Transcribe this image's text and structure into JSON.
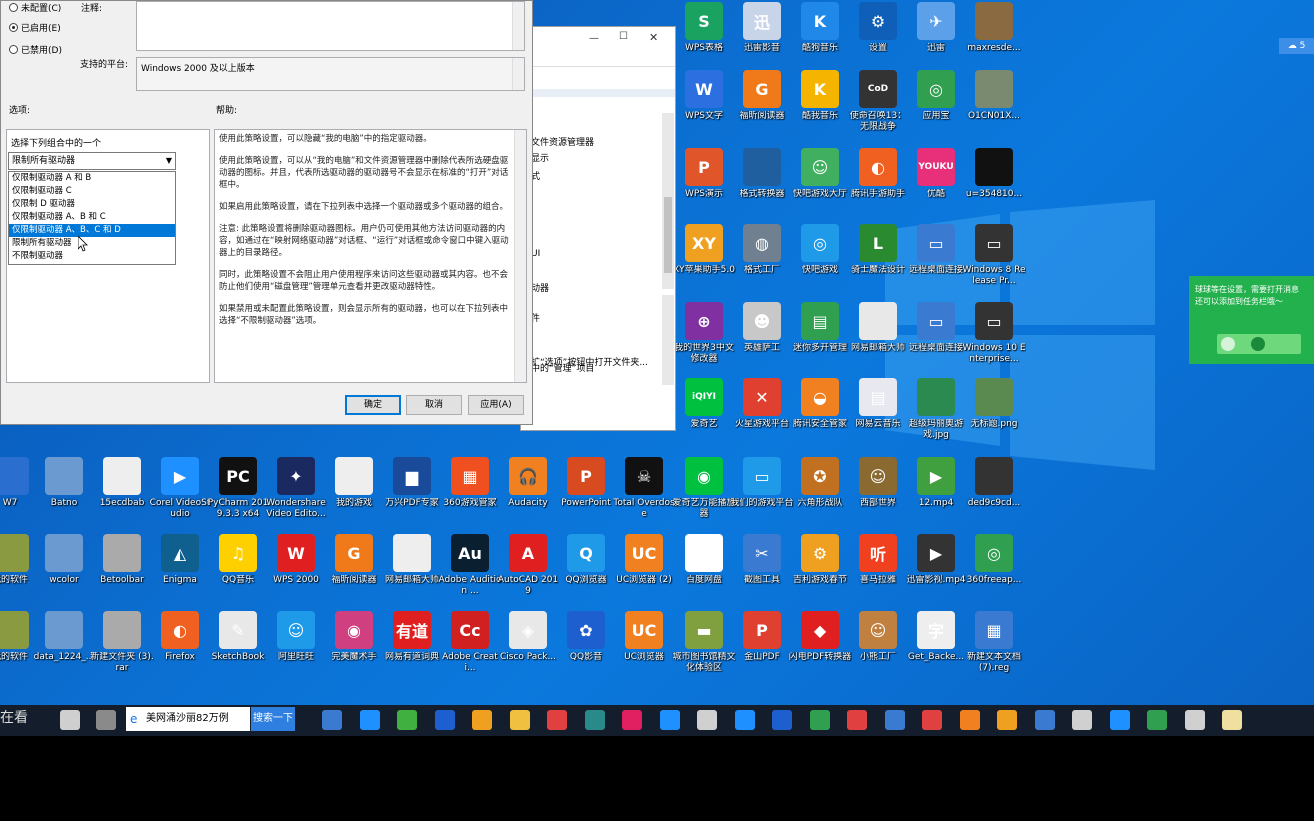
{
  "policy_dialog": {
    "radio_not_configured": "未配置(C)",
    "radio_enabled": "已启用(E)",
    "radio_disabled": "已禁用(D)",
    "comment_label": "注释:",
    "supported_label": "支持的平台:",
    "supported_value": "Windows 2000 及以上版本",
    "options_label": "选项:",
    "help_label": "帮助:",
    "choose_label": "选择下列组合中的一个",
    "dropdown_selected": "限制所有驱动器",
    "dropdown_options": [
      "仅限制驱动器 A 和 B",
      "仅限制驱动器 C",
      "仅限制 D 驱动器",
      "仅限制驱动器 A、B 和 C",
      "仅限制驱动器 A、B、C 和 D",
      "限制所有驱动器",
      "不限制驱动器"
    ],
    "help_paragraphs": [
      "使用此策略设置，可以隐藏“我的电脑”中的指定驱动器。",
      "使用此策略设置，可以从“我的电脑”和文件资源管理器中删除代表所选硬盘驱动器的图标。并且，代表所选驱动器的驱动器号不会显示在标准的“打开”对话框中。",
      "如果启用此策略设置，请在下拉列表中选择一个驱动器或多个驱动器的组合。",
      "注意: 此策略设置将删除驱动器图标。用户仍可使用其他方法访问驱动器的内容，如通过在“映射网络驱动器”对话框、“运行”对话框或命令窗口中键入驱动器上的目录路径。",
      "同时，此策略设置不会阻止用户使用程序来访问这些驱动器或其内容。也不会防止他们使用“磁盘管理”管理单元查看并更改驱动器特性。",
      "如果禁用或未配置此策略设置，则会显示所有的驱动器，也可以在下拉列表中选择“不限制驱动器”选项。"
    ],
    "ok": "确定",
    "cancel": "取消",
    "apply": "应用(A)"
  },
  "explorer_window": {
    "lines": [
      "文件资源管理器",
      "显示",
      "式",
      "UI",
      "动器",
      "件",
      "文件夹",
      "扩“选项”按钮中打开文件夹...",
      "中的“管理”项目"
    ]
  },
  "desktop_icons": [
    {
      "label": "WPS表格",
      "color": "#1aa260",
      "glyph": "S"
    },
    {
      "label": "迅雷影音",
      "color": "#c8d4e8",
      "glyph": "迅"
    },
    {
      "label": "酷狗音乐",
      "color": "#1f88e8",
      "glyph": "K"
    },
    {
      "label": "设置",
      "color": "#0f5fb8",
      "glyph": "⚙"
    },
    {
      "label": "迅雷",
      "color": "#5ba0e8",
      "glyph": "✈"
    },
    {
      "label": "maxresde...",
      "color": "#8a6a40",
      "glyph": ""
    },
    {
      "label": "WPS文字",
      "color": "#2b6fe0",
      "glyph": "W"
    },
    {
      "label": "福昕阅读器",
      "color": "#f07a1a",
      "glyph": "G"
    },
    {
      "label": "酷我音乐",
      "color": "#f5b400",
      "glyph": "K"
    },
    {
      "label": "使命召唤13：无限战争",
      "color": "#333",
      "glyph": "CoD"
    },
    {
      "label": "应用宝",
      "color": "#30a050",
      "glyph": "◎"
    },
    {
      "label": "O1CN01X...",
      "color": "#7a8a70",
      "glyph": ""
    },
    {
      "label": "WPS演示",
      "color": "#e0552a",
      "glyph": "P"
    },
    {
      "label": "格式转换器",
      "color": "#1f5fa0",
      "glyph": ""
    },
    {
      "label": "快吧游戏大厅",
      "color": "#40b060",
      "glyph": "☺"
    },
    {
      "label": "腾讯手游助手",
      "color": "#f06020",
      "glyph": "◐"
    },
    {
      "label": "优酷",
      "color": "#e8307a",
      "glyph": "YOUKU"
    },
    {
      "label": "u=354810...",
      "color": "#111",
      "glyph": ""
    },
    {
      "label": "XY苹果助手5.0",
      "color": "#f0a020",
      "glyph": "XY"
    },
    {
      "label": "格式工厂",
      "color": "#708090",
      "glyph": "◍"
    },
    {
      "label": "快吧游戏",
      "color": "#1e9ae8",
      "glyph": "◎"
    },
    {
      "label": "骑士魔法设计",
      "color": "#2a8a30",
      "glyph": "L"
    },
    {
      "label": "远程桌面连接",
      "color": "#3a7ad0",
      "glyph": "▭"
    },
    {
      "label": "Windows 8 Release Pr...",
      "color": "#333",
      "glyph": "▭"
    },
    {
      "label": "我的世界3中文修改器",
      "color": "#8030a0",
      "glyph": "⊕"
    },
    {
      "label": "英雄萨工",
      "color": "#c8c8c8",
      "glyph": "☻"
    },
    {
      "label": "迷你多开管理",
      "color": "#30a050",
      "glyph": "▤"
    },
    {
      "label": "网易邮箱大师",
      "color": "#e8e8e8",
      "glyph": ""
    },
    {
      "label": "远程桌面连接",
      "color": "#3a7ad0",
      "glyph": "▭"
    },
    {
      "label": "Windows 10 Enterprise...",
      "color": "#333",
      "glyph": "▭"
    },
    {
      "label": "爱奇艺",
      "color": "#00c040",
      "glyph": "iQIYI"
    },
    {
      "label": "火星游戏平台",
      "color": "#e04030",
      "glyph": "✕"
    },
    {
      "label": "腾讯安全管家",
      "color": "#f08020",
      "glyph": "◒"
    },
    {
      "label": "网易云音乐",
      "color": "#e8e8f0",
      "glyph": "▤"
    },
    {
      "label": "超级玛丽奥游戏.jpg",
      "color": "#2a8a50",
      "glyph": ""
    },
    {
      "label": "无标题.png",
      "color": "#5a8a50",
      "glyph": ""
    },
    {
      "label": "W7",
      "color": "#2a6fd0",
      "glyph": ""
    },
    {
      "label": "Batno",
      "color": "#6a9ad0",
      "glyph": ""
    },
    {
      "label": "15ecdbab",
      "color": "#eee",
      "glyph": ""
    },
    {
      "label": "Corel VideoStudio",
      "color": "#1e90ff",
      "glyph": "▶"
    },
    {
      "label": "PyCharm 2019.3.3 x64",
      "color": "#111",
      "glyph": "PC"
    },
    {
      "label": "Wondershare Video Edito...",
      "color": "#1a2a60",
      "glyph": "✦"
    },
    {
      "label": "我的游戏",
      "color": "#eee",
      "glyph": ""
    },
    {
      "label": "万兴PDF专家",
      "color": "#1a4a9a",
      "glyph": "▆"
    },
    {
      "label": "360游戏管家",
      "color": "#f05020",
      "glyph": "▦"
    },
    {
      "label": "Audacity",
      "color": "#f08020",
      "glyph": "🎧"
    },
    {
      "label": "PowerPoint",
      "color": "#d84a20",
      "glyph": "P"
    },
    {
      "label": "Total Overdose",
      "color": "#111",
      "glyph": "☠"
    },
    {
      "label": "爱奇艺万能播放器",
      "color": "#00c040",
      "glyph": "◉"
    },
    {
      "label": "我们的游戏平台",
      "color": "#1e9ae8",
      "glyph": "▭"
    },
    {
      "label": "六角形战队",
      "color": "#c07020",
      "glyph": "✪"
    },
    {
      "label": "西部世界",
      "color": "#8a6a30",
      "glyph": "☺"
    },
    {
      "label": "12.mp4",
      "color": "#40a040",
      "glyph": "▶"
    },
    {
      "label": "ded9c9cd...",
      "color": "#333",
      "glyph": ""
    },
    {
      "label": "我的软件",
      "color": "#8a9a40",
      "glyph": ""
    },
    {
      "label": "wcolor",
      "color": "#6a9ad0",
      "glyph": ""
    },
    {
      "label": "Betoolbar",
      "color": "#aaa",
      "glyph": ""
    },
    {
      "label": "Enigma",
      "color": "#0f5f8f",
      "glyph": "◭"
    },
    {
      "label": "QQ音乐",
      "color": "#ffd000",
      "glyph": "♫"
    },
    {
      "label": "WPS 2000",
      "color": "#e02020",
      "glyph": "W"
    },
    {
      "label": "福昕阅读器",
      "color": "#f07a1a",
      "glyph": "G"
    },
    {
      "label": "网易邮箱大师",
      "color": "#eee",
      "glyph": ""
    },
    {
      "label": "Adobe Audition ...",
      "color": "#0a1f30",
      "glyph": "Au"
    },
    {
      "label": "AutoCAD 2019",
      "color": "#e02020",
      "glyph": "A"
    },
    {
      "label": "QQ浏览器",
      "color": "#1e9ae8",
      "glyph": "Q"
    },
    {
      "label": "UC浏览器 (2)",
      "color": "#f08020",
      "glyph": "UC"
    },
    {
      "label": "百度网盘",
      "color": "#fff",
      "glyph": "◆"
    },
    {
      "label": "截图工具",
      "color": "#3a7ad0",
      "glyph": "✂"
    },
    {
      "label": "吉利游戏春节",
      "color": "#f0a020",
      "glyph": "⚙"
    },
    {
      "label": "喜马拉雅",
      "color": "#f04020",
      "glyph": "听"
    },
    {
      "label": "迅雷影视.mp4",
      "color": "#333",
      "glyph": "▶"
    },
    {
      "label": "360freeap...",
      "color": "#30a050",
      "glyph": "◎"
    },
    {
      "label": "我的软件",
      "color": "#8a9a40",
      "glyph": ""
    },
    {
      "label": "data_1224_...",
      "color": "#6a9ad0",
      "glyph": ""
    },
    {
      "label": "新建文件夹 (3).rar",
      "color": "#aaa",
      "glyph": ""
    },
    {
      "label": "Firefox",
      "color": "#f06020",
      "glyph": "◐"
    },
    {
      "label": "SketchBook",
      "color": "#e8e8e8",
      "glyph": "✎"
    },
    {
      "label": "阿里旺旺",
      "color": "#1e9ae8",
      "glyph": "☺"
    },
    {
      "label": "完美魔术手",
      "color": "#d04080",
      "glyph": "◉"
    },
    {
      "label": "网易有道词典",
      "color": "#e02020",
      "glyph": "有道"
    },
    {
      "label": "Adobe Creati...",
      "color": "#d02020",
      "glyph": "Cc"
    },
    {
      "label": "Cisco Pack...",
      "color": "#e8e8e8",
      "glyph": "◈"
    },
    {
      "label": "QQ影音",
      "color": "#1e5fd0",
      "glyph": "✿"
    },
    {
      "label": "UC浏览器",
      "color": "#f08020",
      "glyph": "UC"
    },
    {
      "label": "城市图书馆精文化体验区",
      "color": "#80a040",
      "glyph": "▬"
    },
    {
      "label": "金山PDF",
      "color": "#e04030",
      "glyph": "P"
    },
    {
      "label": "闪电PDF转换器",
      "color": "#e02020",
      "glyph": "◆"
    },
    {
      "label": "小熊工厂",
      "color": "#c08040",
      "glyph": "☺"
    },
    {
      "label": "Get_Backe...",
      "color": "#eee",
      "glyph": "字"
    },
    {
      "label": "新建文本文档 (7).reg",
      "color": "#3a7ad0",
      "glyph": "▦"
    }
  ],
  "notification": {
    "text1": "球球等在设置，需要打开消息",
    "text2": "还可以添加到任务栏哦～"
  },
  "cloud_button": "☁ 5",
  "taskbar": {
    "left_text": "在看",
    "search_text": "美网涌沙丽82万例",
    "search_button": "搜索一下"
  }
}
